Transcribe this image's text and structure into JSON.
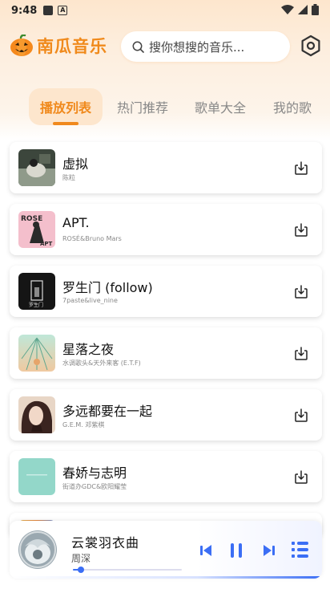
{
  "status_bar": {
    "time": "9:48",
    "icons": [
      "notification-square-icon",
      "a-letter-icon",
      "wifi-icon",
      "cellular-signal-icon",
      "battery-icon"
    ],
    "a_glyph": "A"
  },
  "app": {
    "name": "南瓜音乐",
    "logo_icon": "pumpkin-icon",
    "brand_color": "#f08a1c"
  },
  "search": {
    "placeholder": "搜你想搜的音乐...",
    "icon": "search-icon"
  },
  "settings": {
    "icon": "settings-hexagon-icon"
  },
  "tabs": [
    {
      "label": "播放列表",
      "active": true
    },
    {
      "label": "热门推荐",
      "active": false
    },
    {
      "label": "歌单大全",
      "active": false
    },
    {
      "label": "我的歌",
      "active": false
    }
  ],
  "songs": [
    {
      "title": "虚拟",
      "artist": "陈粒",
      "cover_colors": [
        "#2e3a2e",
        "#c9c9c0"
      ]
    },
    {
      "title": "APT.",
      "artist": "ROSÉ&Bruno Mars",
      "cover_colors": [
        "#f3b8c6",
        "#2a2a2a"
      ],
      "cover_text": [
        "ROSE",
        "APT"
      ]
    },
    {
      "title": "罗生门 (follow)",
      "artist": "7paste&live_nine",
      "cover_colors": [
        "#151515",
        "#dcdcdc"
      ],
      "cover_text": [
        "罗生门"
      ]
    },
    {
      "title": "星落之夜",
      "artist": "水调歌头&天外来客 (E.T.F)",
      "cover_colors": [
        "#9fd9c4",
        "#e9c9a0"
      ]
    },
    {
      "title": "多远都要在一起",
      "artist": "G.E.M. 邓紫棋",
      "cover_colors": [
        "#3a2420",
        "#e9d2c0"
      ]
    },
    {
      "title": "春娇与志明",
      "artist": "街道办GDC&欧阳耀莹",
      "cover_colors": [
        "#8fd6c8",
        "#b5e6dc"
      ]
    }
  ],
  "player": {
    "title": "云裳羽衣曲",
    "artist": "周深",
    "progress": 0.07,
    "accent": "#3b6ef5",
    "buttons": [
      "previous-icon",
      "pause-icon",
      "next-icon",
      "playlist-icon"
    ]
  }
}
